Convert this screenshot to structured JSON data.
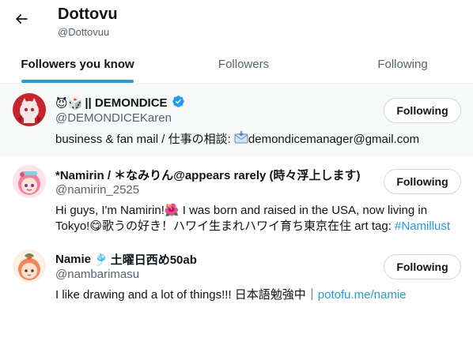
{
  "header": {
    "title": "Dottovu",
    "handle": "@Dottovuu",
    "back_icon": "arrow-left-icon"
  },
  "tabs": [
    {
      "label": "Followers you know",
      "active": true
    },
    {
      "label": "Followers",
      "active": false
    },
    {
      "label": "Following",
      "active": false
    }
  ],
  "accent_color": "#1d9bf0",
  "users": [
    {
      "name_prefix_emoji": "😈🎲",
      "name": "|| DEMONDICE",
      "verified": true,
      "handle": "@DEMONDICEKaren",
      "button_label": "Following",
      "bio_text": "business & fan mail / 仕事の相談: ",
      "bio_email_icon": "email-icon",
      "bio_email": "demondicemanager@gmail.com"
    },
    {
      "name": "*Namirin / ＊なみりん@appears rarely (時々浮上します)",
      "handle": "@namirin_2525",
      "button_label": "Following",
      "bio_line1": "Hi guys, I'm Namirin!",
      "bio_line1_emoji": "🌺",
      "bio_line1_rest": " I was born and raised in the USA, now living in",
      "bio_line2_start": "Tokyo!",
      "bio_line2_emoji": "😋",
      "bio_line2_rest": "歌うの好き！ハワイ生まれハワイ育ち東京在住 art tag: ",
      "bio_hashtag": "#Namillust"
    },
    {
      "name": "Namie",
      "name_emoji": "🎐",
      "name_suffix": "土曜日西め50ab",
      "handle": "@nambarimasu",
      "button_label": "Following",
      "bio_text": "I like drawing and a lot of things!!! 日本語勉強中｜",
      "bio_link": "potofu.me/namie"
    }
  ]
}
